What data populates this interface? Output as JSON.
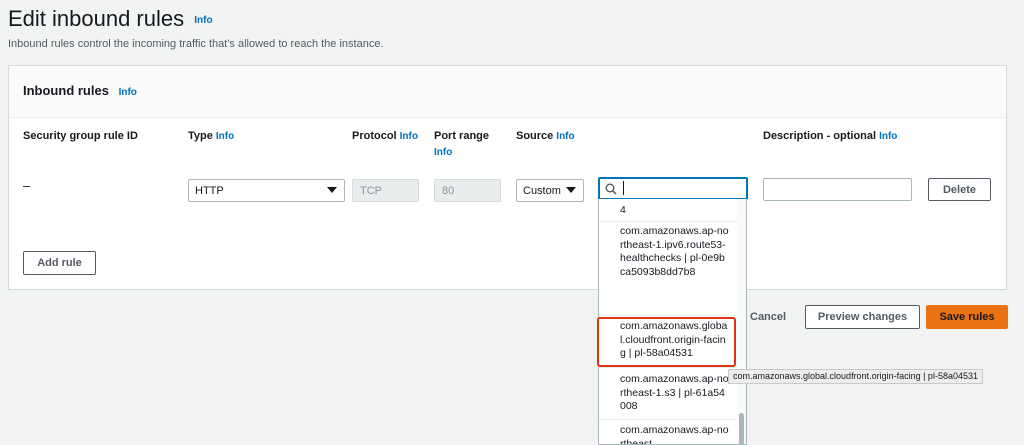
{
  "page": {
    "title": "Edit inbound rules",
    "title_info": "Info",
    "description": "Inbound rules control the incoming traffic that's allowed to reach the instance."
  },
  "panel": {
    "title": "Inbound rules",
    "title_info": "Info",
    "columns": {
      "rule_id": "Security group rule ID",
      "type": "Type",
      "type_info": "Info",
      "protocol": "Protocol",
      "protocol_info": "Info",
      "port_range": "Port range",
      "port_range_info": "Info",
      "source": "Source",
      "source_info": "Info",
      "description": "Description - optional",
      "description_info": "Info"
    },
    "rule": {
      "rule_id": "–",
      "type": "HTTP",
      "protocol": "TCP",
      "port_range": "80",
      "source_mode": "Custom",
      "search_value": "",
      "description_value": "",
      "delete_label": "Delete"
    },
    "add_rule_label": "Add rule"
  },
  "dropdown": {
    "options": [
      "4",
      "com.amazonaws.ap-northeast-1.ipv6.route53-healthchecks | pl-0e9bca5093b8dd7b8",
      "com.amazonaws.global.cloudfront.origin-facing | pl-58a04531",
      "com.amazonaws.ap-northeast-1.s3 | pl-61a54008",
      "com.amazonaws.ap-northeast"
    ],
    "tooltip": "com.amazonaws.global.cloudfront.origin-facing | pl-58a04531"
  },
  "footer": {
    "cancel_label": "Cancel",
    "preview_label": "Preview changes",
    "save_label": "Save rules"
  },
  "colors": {
    "accent": "#0073bb",
    "primary_button": "#ec7211",
    "highlight": "#df3312"
  }
}
